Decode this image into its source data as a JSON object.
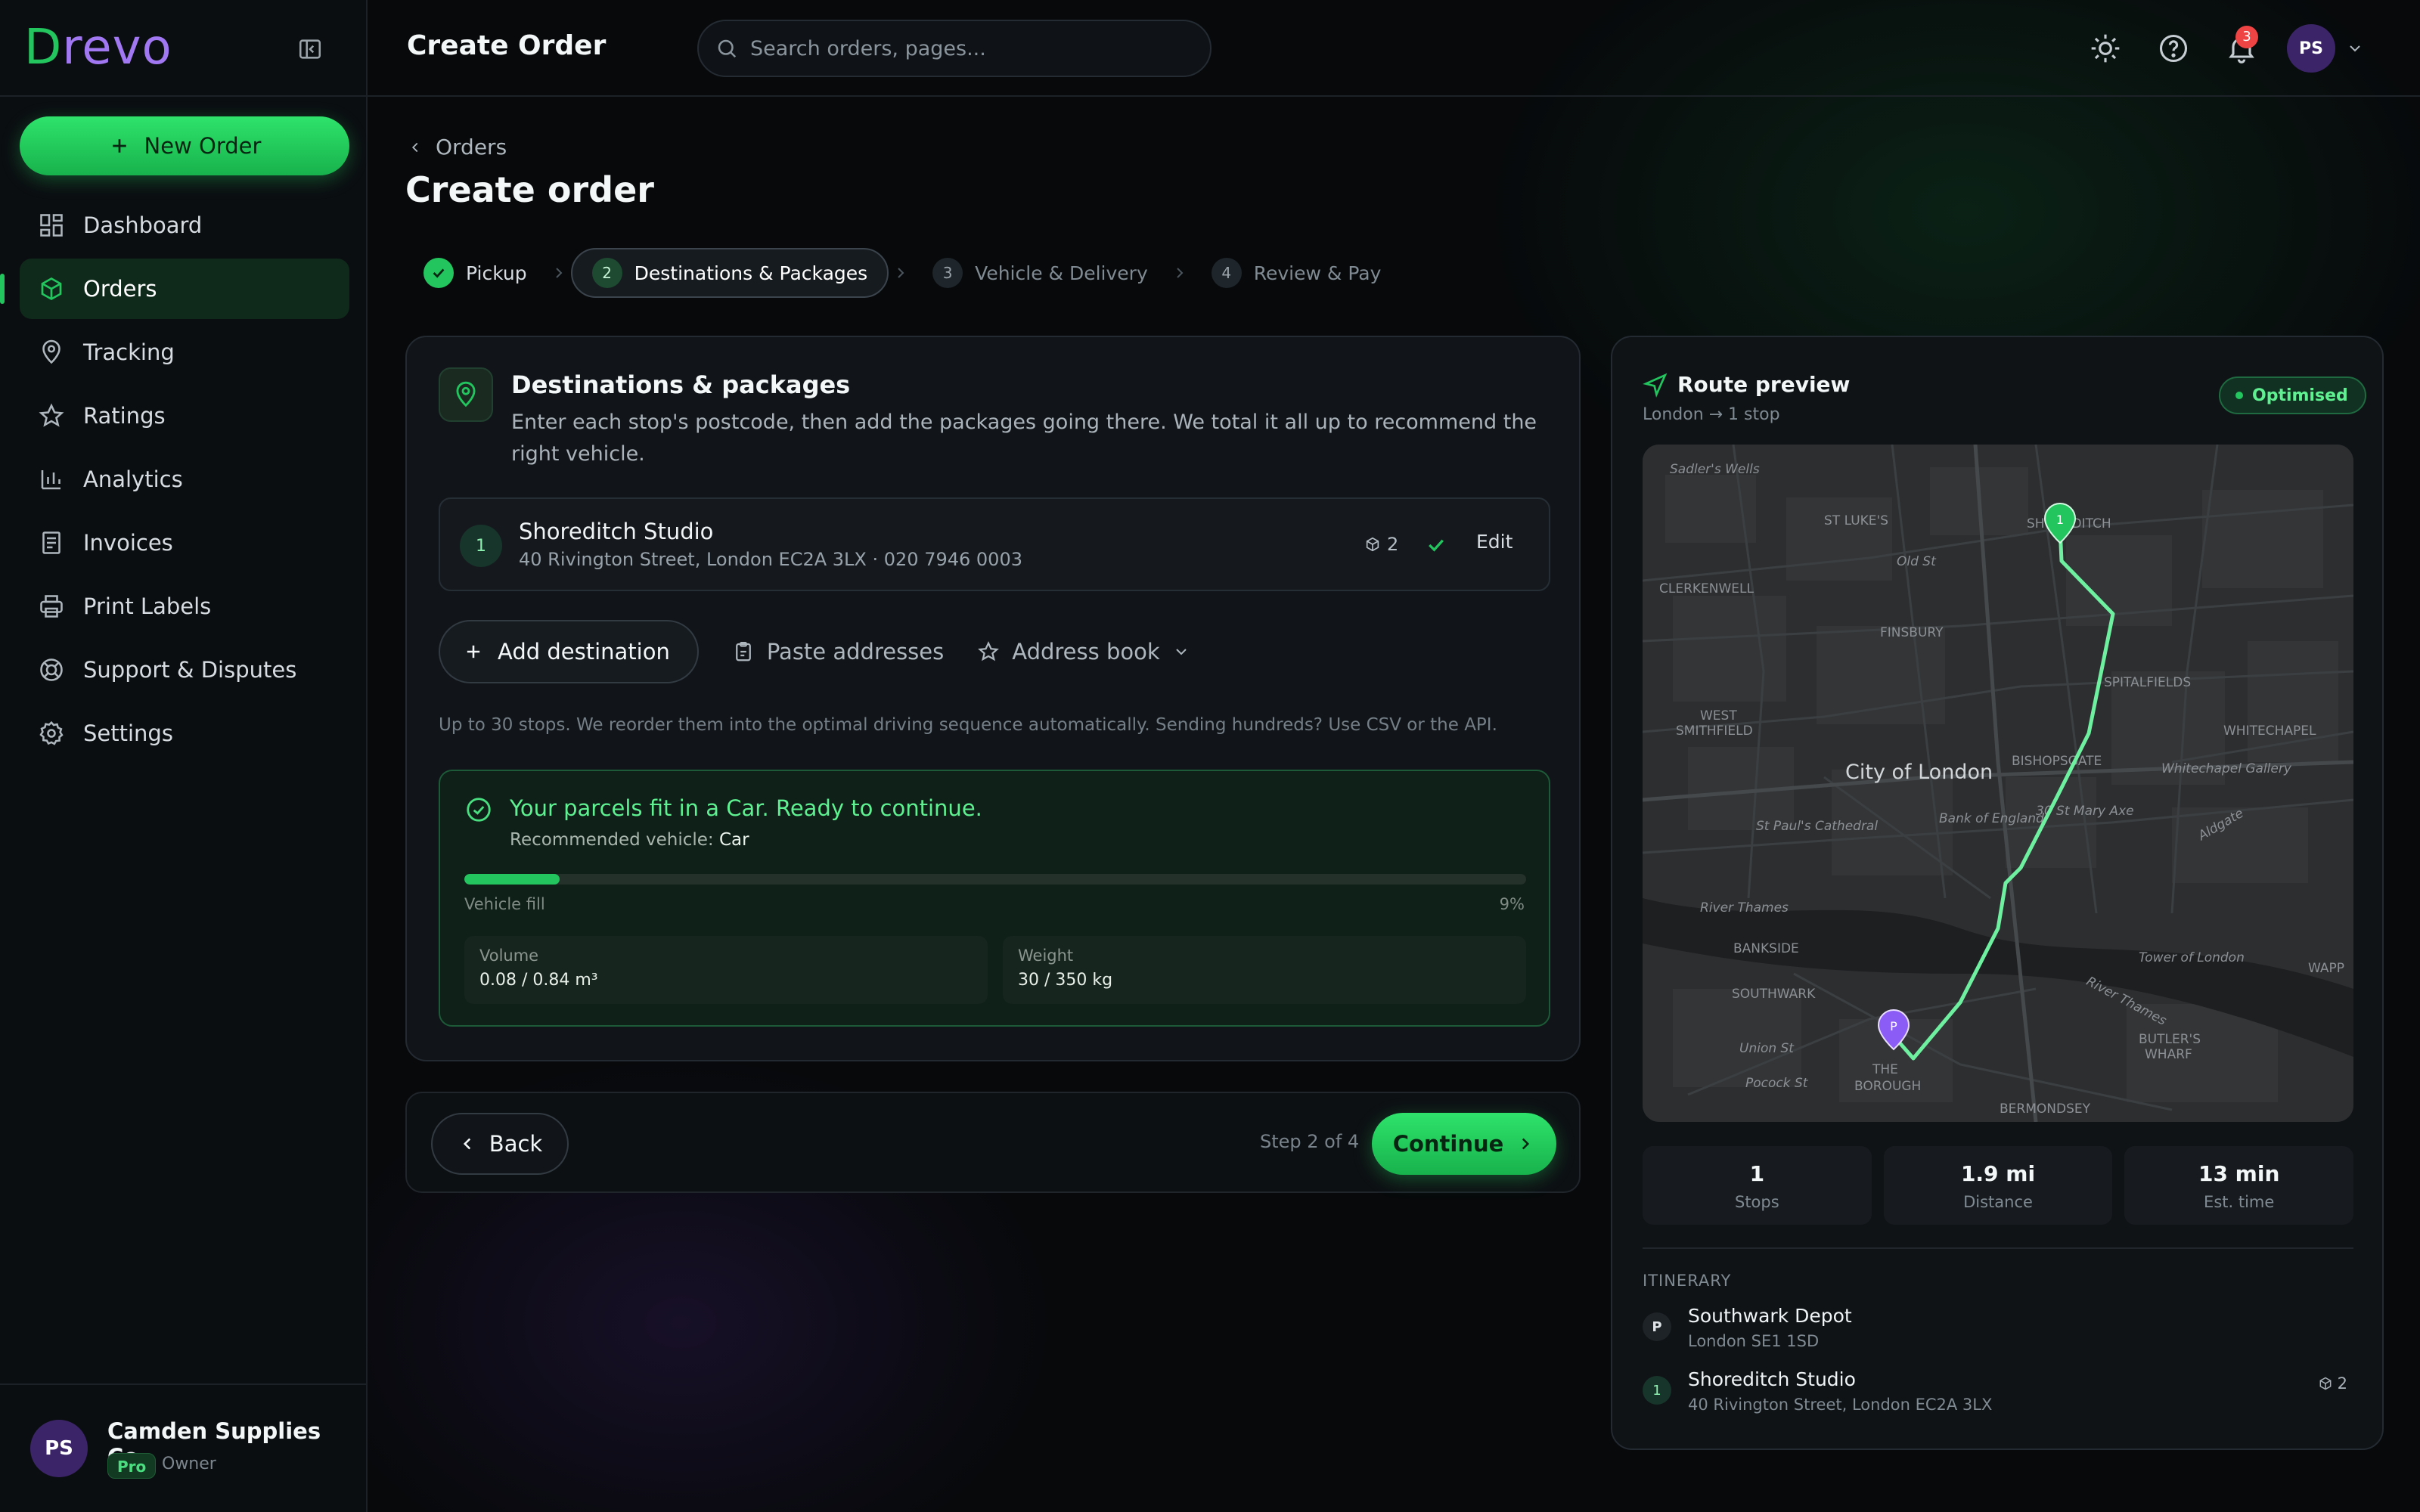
{
  "brand": {
    "name": "Drevo"
  },
  "sidebar": {
    "new_order_label": "New Order",
    "items": [
      {
        "label": "Dashboard",
        "icon": "dashboard-icon"
      },
      {
        "label": "Orders",
        "icon": "box-icon",
        "active": true
      },
      {
        "label": "Tracking",
        "icon": "map-pin-icon"
      },
      {
        "label": "Ratings",
        "icon": "star-icon"
      },
      {
        "label": "Analytics",
        "icon": "bar-chart-icon"
      },
      {
        "label": "Invoices",
        "icon": "receipt-icon"
      },
      {
        "label": "Print Labels",
        "icon": "printer-icon"
      },
      {
        "label": "Support & Disputes",
        "icon": "lifebuoy-icon"
      },
      {
        "label": "Settings",
        "icon": "gear-icon"
      }
    ],
    "footer": {
      "initials": "PS",
      "company": "Camden Supplies Co.",
      "plan": "Pro",
      "role": "Owner"
    }
  },
  "header": {
    "title": "Create Order",
    "search_placeholder": "Search orders, pages...",
    "notification_count": "3",
    "user_initials": "PS"
  },
  "page": {
    "breadcrumb": "Orders",
    "title": "Create order",
    "steps": [
      {
        "num": "",
        "label": "Pickup",
        "state": "done"
      },
      {
        "num": "2",
        "label": "Destinations & Packages",
        "state": "current"
      },
      {
        "num": "3",
        "label": "Vehicle & Delivery",
        "state": "upcoming"
      },
      {
        "num": "4",
        "label": "Review & Pay",
        "state": "upcoming"
      }
    ]
  },
  "destinations": {
    "title": "Destinations & packages",
    "description": "Enter each stop's postcode, then add the packages going there. We total it all up to recommend the right vehicle.",
    "stops": [
      {
        "num": "1",
        "name": "Shoreditch Studio",
        "address": "40 Rivington Street, London EC2A 3LX · 020 7946 0003",
        "packages": "2",
        "edit_label": "Edit"
      }
    ],
    "add_label": "Add destination",
    "paste_label": "Paste addresses",
    "address_book_label": "Address book",
    "hint": "Up to 30 stops. We reorder them into the optimal driving sequence automatically. Sending hundreds? Use CSV or the API."
  },
  "fit": {
    "title": "Your parcels fit in a Car. Ready to continue.",
    "recommended_prefix": "Recommended vehicle:",
    "recommended_vehicle": "Car",
    "fill_label": "Vehicle fill",
    "fill_percent_text": "9%",
    "fill_fraction": 0.09,
    "volume_label": "Volume",
    "volume_value": "0.08 / 0.84 m³",
    "weight_label": "Weight",
    "weight_value": "30 / 350 kg"
  },
  "actions": {
    "back_label": "Back",
    "step_text": "Step 2 of 4",
    "continue_label": "Continue"
  },
  "route": {
    "title": "Route preview",
    "subtitle": "London → 1 stop",
    "badge": "Optimised",
    "map_labels": {
      "sadlers_wells": "Sadler's Wells",
      "st_lukes": "ST LUKE'S",
      "shoreditch": "SHOREDITCH",
      "old_st": "Old St",
      "clerkenwell": "CLERKENWELL",
      "finsbury": "FINSBURY",
      "spitalfields": "SPITALFIELDS",
      "west": "WEST",
      "smithfield": "SMITHFIELD",
      "whitechapel": "WHITECHAPEL",
      "city_of_london": "City of London",
      "bishopsgate": "BISHOPSGATE",
      "whitechapel_gallery": "Whitechapel Gallery",
      "st_pauls": "St Paul's Cathedral",
      "bank_of_england": "Bank of England",
      "st_mary_axe": "30 St Mary Axe",
      "aldgate": "Aldgate",
      "river_thames_1": "River Thames",
      "bankside": "BANKSIDE",
      "tower_of_london": "Tower of London",
      "wapping": "WAPP",
      "southwark": "SOUTHWARK",
      "river_thames_2": "River Thames",
      "union_st": "Union St",
      "butlers_1": "BUTLER'S",
      "butlers_2": "WHARF",
      "the": "THE",
      "borough": "BOROUGH",
      "pocock_st": "Pocock St",
      "bermondsey": "BERMONDSEY",
      "pin_p": "P",
      "pin_1": "1"
    },
    "stats": [
      {
        "value": "1",
        "label": "Stops"
      },
      {
        "value": "1.9 mi",
        "label": "Distance"
      },
      {
        "value": "13 min",
        "label": "Est. time"
      }
    ],
    "itinerary_label": "ITINERARY",
    "itinerary": [
      {
        "badge": "P",
        "name": "Southwark Depot",
        "address": "London SE1 1SD",
        "packages": ""
      },
      {
        "badge": "1",
        "name": "Shoreditch Studio",
        "address": "40 Rivington Street, London EC2A 3LX",
        "packages": "2"
      }
    ]
  },
  "colors": {
    "accent": "#22c55e",
    "brand_purple": "#a278f2",
    "notification": "#ef4444"
  }
}
